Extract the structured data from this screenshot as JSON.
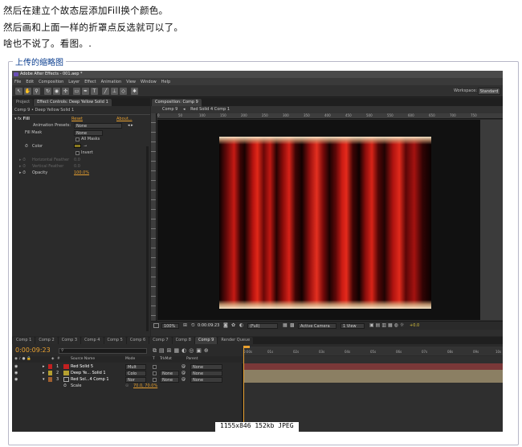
{
  "post": {
    "line1": "然后在建立个故态层添加Fill换个颜色。",
    "line2": "然后画和上面一样的折罩点反选就可以了。",
    "line3": "啥也不说了。看图。."
  },
  "thumbnail": {
    "legend": "上传的缩略图",
    "info": "1155x846 152kb JPEG"
  },
  "app": {
    "title": "Adobe After Effects - 001.aep *",
    "menu": [
      "File",
      "Edit",
      "Composition",
      "Layer",
      "Effect",
      "Animation",
      "View",
      "Window",
      "Help"
    ],
    "workspace_label": "Workspace:",
    "workspace_value": "Standard",
    "left_tabs": [
      "Project",
      "Effect Controls: Deep Yellow Solid 1"
    ],
    "effect_breadcrumb": "Comp 9 • Deep Yellow Solid 1",
    "effect": {
      "name": "Fill",
      "reset": "Reset",
      "about": "About...",
      "presets_label": "Animation Presets:",
      "presets_value": "None",
      "fillmask_label": "Fill Mask",
      "fillmask_value": "None",
      "allmasks_label": "All Masks",
      "color_label": "Color",
      "invert_label": "Invert",
      "hfeather_label": "Horizontal Feather",
      "hfeather_value": "0.0",
      "vfeather_label": "Vertical Feather",
      "vfeather_value": "0.0",
      "opacity_label": "Opacity",
      "opacity_value": "100.0%",
      "color_hex": "#8a7a1e"
    },
    "comp_panel_tab": "Composition: Comp 9",
    "comp_crumbs": [
      "Comp 9",
      "Red Solid 4 Comp 1"
    ],
    "ruler_marks": [
      "0",
      "50",
      "100",
      "150",
      "200",
      "250",
      "300",
      "350",
      "400",
      "450",
      "500",
      "550",
      "600",
      "650",
      "700",
      "750"
    ],
    "viewer": {
      "zoom": "100%",
      "timecode": "0:00:09:23",
      "resolution": "(Full)",
      "camera": "Active Camera",
      "views": "1 View",
      "exposure": "+0.0"
    },
    "timeline_tabs": [
      "Comp 1",
      "Comp 2",
      "Comp 3",
      "Comp 4",
      "Comp 5",
      "Comp 6",
      "Comp 7",
      "Comp 8",
      "Comp 9",
      "Render Queue"
    ],
    "active_timeline_tab": "Comp 9",
    "timecode": "0:00:09:23",
    "columns": {
      "source": "Source Name",
      "mode": "Mode",
      "t": "T",
      "trkmat": "TrkMat",
      "parent": "Parent"
    },
    "time_marks": [
      "0:00s",
      "01s",
      "02s",
      "03s",
      "04s",
      "05s",
      "06s",
      "07s",
      "08s",
      "09s",
      "10s"
    ],
    "layers": [
      {
        "num": "1",
        "name": "Red Solid 5",
        "mode": "Mult",
        "trkmat": "",
        "parent": "None",
        "color": "#c22020",
        "bar": "#8a3a3a"
      },
      {
        "num": "2",
        "name": "Deep Ye... Solid 1",
        "mode": "Colo",
        "trkmat": "None",
        "parent": "None",
        "color": "#b5a030",
        "bar": "#8b7f63"
      },
      {
        "num": "3",
        "name": "Red Sol...4 Comp 1",
        "mode": "Nor",
        "trkmat": "None",
        "parent": "None",
        "color": "#a06030",
        "bar": "#8b7f63"
      }
    ],
    "scale_label": "Scale",
    "scale_value": "70.0, 70.0%"
  }
}
